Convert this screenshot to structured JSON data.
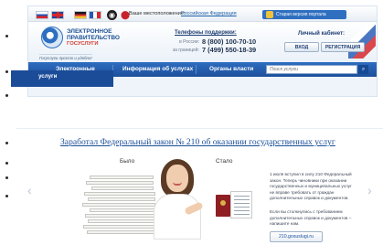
{
  "topbar": {
    "languages": [
      "RU",
      "EN",
      "DE",
      "FR"
    ],
    "location_label": "Ваше местоположение:",
    "location_value": "Российская Федерация",
    "old_portal_button": "Старая версия портала"
  },
  "header": {
    "logo_line1": "ЭЛЕКТРОННОЕ",
    "logo_line2": "ПРАВИТЕЛЬСТВО",
    "logo_line3": "ГОСУСЛУГИ",
    "tagline": "Госуслуги просто и удобно!",
    "support_title": "Телефоны поддержки:",
    "phone_ru_label": "в России:",
    "phone_ru": "8 (800) 100-70-10",
    "phone_abroad_label": "за границей:",
    "phone_abroad": "7 (499) 550-18-39",
    "cabinet_title": "Личный кабинет:",
    "login_button": "ВХОД",
    "register_button": "РЕГИСТРАЦИЯ"
  },
  "nav": {
    "items": [
      "Электронные",
      "Информация об услугах",
      "Органы власти"
    ],
    "dropdown_item": "услуги",
    "search_placeholder": "Поиск услуги"
  },
  "banner": {
    "title": "Заработал Федеральный закон № 210 об оказании государственных услуг",
    "before_label": "Было",
    "after_label": "Стало",
    "info_text": "1 июля вступил в силу 210 Федеральный закон. Теперь чиновники при оказании государственных и муниципальных услуг не вправе требовать от граждан дополнительных справок и документов.",
    "info_text2": "Если вы столкнулись с требованием дополнительных справок и документов – напишите нам.",
    "link_text": "210.gosuslugi.ru"
  },
  "colors": {
    "nav_blue": "#2e6dc0",
    "brand_dark_blue": "#1d4f95",
    "brand_red": "#d33b31"
  }
}
